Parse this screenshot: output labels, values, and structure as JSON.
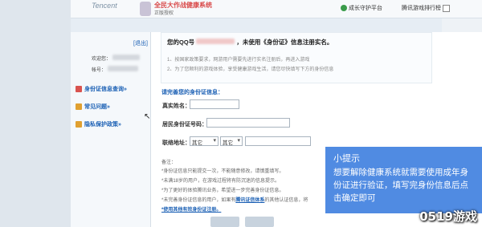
{
  "header": {
    "logo_text": "Tencent",
    "brand_title": "全民大作战健康系统",
    "brand_sub": "正版授权",
    "guardian_label": "成长守护平台",
    "rank_label": "腾讯游戏排行榜"
  },
  "sidebar": {
    "exit_label": "[退出]",
    "field1_label": "欢迎您：",
    "field2_label": "帐号：",
    "nav": [
      {
        "label": "身份证信息查询»"
      },
      {
        "label": "常见问题»"
      },
      {
        "label": "隐私保护政策»"
      }
    ]
  },
  "notice": {
    "qq_prefix": "您的QQ号",
    "qq_suffix": "，未使用《身份证》信息注册实名。",
    "tip1": "1、按国家政策要求，网游用户需要先进行实名注册后，再进入游戏",
    "tip2": "2、为了您顺利的游戏体验，享受健康游戏生活，请您尽快填写下方的身份信息"
  },
  "form": {
    "section_title": "请完善您的身份证信息：",
    "name_label": "真实姓名：",
    "id_label": "居民身份证号码：",
    "address_label": "联络地址：",
    "province_value": "其它",
    "city_value": "其它"
  },
  "notes": {
    "heading": "备注：",
    "line1": "*身份证信息只能提交一次，不能随意修改，请慎重填写。",
    "line2": "*未满18岁的用户，在游戏过程将有防沉迷的信息提示。",
    "line3": "*为了更好的体验腾讯业务，希望进一步完善身份证信息。",
    "line4_prefix": "*未完善身份证信息的用户，如果有",
    "line4_link": "腾讯证信体系",
    "line4_suffix": "的其他认证信息，将",
    "link_more": "*使用其他有效身份证注册。"
  },
  "overlay": {
    "title": "小提示",
    "body": "想要解除健康系统就需要使用成年身份证进行验证，填写完身份信息后点击确定即可"
  },
  "watermark": "0519游戏"
}
